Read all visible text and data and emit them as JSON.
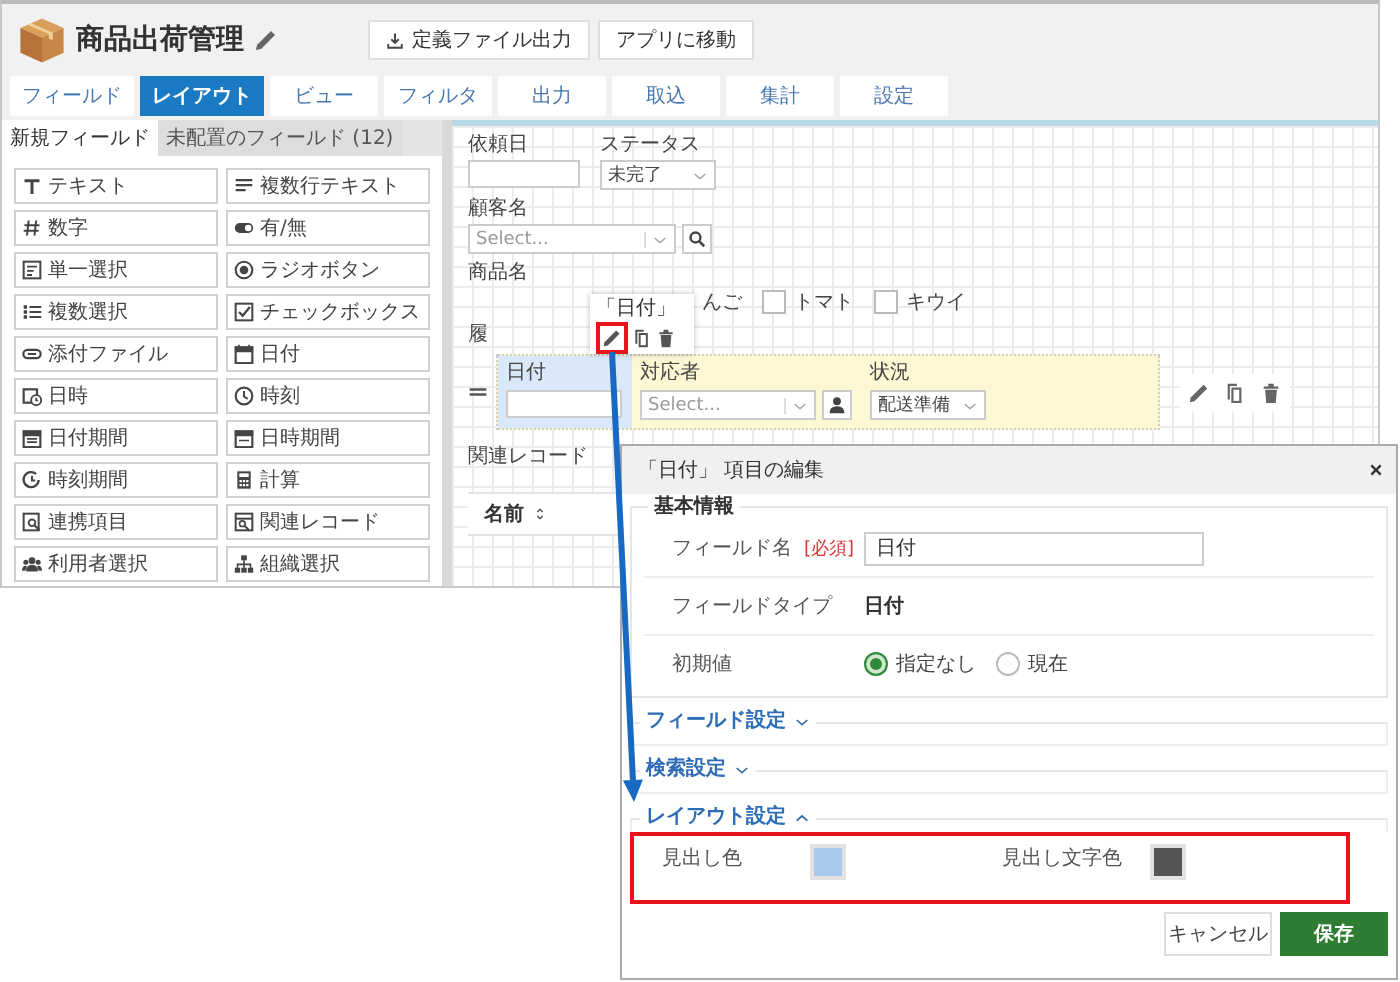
{
  "app": {
    "title": "商品出荷管理",
    "header_buttons": [
      {
        "label": "定義ファイル出力",
        "kind": "download"
      },
      {
        "label": "アプリに移動",
        "kind": "plain"
      }
    ],
    "tabs": [
      {
        "label": "フィールド",
        "selected": false
      },
      {
        "label": "レイアウト",
        "selected": true
      },
      {
        "label": "ビュー",
        "selected": false
      },
      {
        "label": "フィルタ",
        "selected": false
      },
      {
        "label": "出力",
        "selected": false
      },
      {
        "label": "取込",
        "selected": false
      },
      {
        "label": "集計",
        "selected": false
      },
      {
        "label": "設定",
        "selected": false
      }
    ],
    "sidebar": {
      "tabs": [
        {
          "label": "新規フィールド",
          "selected": true
        },
        {
          "label": "未配置のフィールド (12)",
          "selected": false
        }
      ],
      "items": [
        {
          "label": "テキスト",
          "kind": "text"
        },
        {
          "label": "複数行テキスト",
          "kind": "multiline"
        },
        {
          "label": "数字",
          "kind": "number"
        },
        {
          "label": "有/無",
          "kind": "toggle"
        },
        {
          "label": "単一選択",
          "kind": "select"
        },
        {
          "label": "ラジオボタン",
          "kind": "radio"
        },
        {
          "label": "複数選択",
          "kind": "multiselect"
        },
        {
          "label": "チェックボックス",
          "kind": "checkbox"
        },
        {
          "label": "添付ファイル",
          "kind": "file"
        },
        {
          "label": "日付",
          "kind": "date"
        },
        {
          "label": "日時",
          "kind": "datetime"
        },
        {
          "label": "時刻",
          "kind": "time"
        },
        {
          "label": "日付期間",
          "kind": "daterange"
        },
        {
          "label": "日時期間",
          "kind": "datetimerange"
        },
        {
          "label": "時刻期間",
          "kind": "timerange"
        },
        {
          "label": "計算",
          "kind": "calc"
        },
        {
          "label": "連携項目",
          "kind": "link"
        },
        {
          "label": "関連レコード",
          "kind": "related"
        },
        {
          "label": "利用者選択",
          "kind": "user"
        },
        {
          "label": "組織選択",
          "kind": "org"
        }
      ]
    },
    "canvas": {
      "request_date": {
        "label": "依頼日"
      },
      "status": {
        "label": "ステータス",
        "value": "未完了"
      },
      "customer": {
        "label": "顧客名",
        "placeholder": "Select..."
      },
      "product": {
        "label": "商品名",
        "cut_option": "んご",
        "options": [
          {
            "label": "トマト",
            "checked": false
          },
          {
            "label": "キウイ",
            "checked": false
          }
        ]
      },
      "cut_label": "履",
      "row": {
        "cells": [
          {
            "kind": "date",
            "label": "日付",
            "selected": true
          },
          {
            "kind": "user",
            "label": "対応者",
            "placeholder": "Select..."
          },
          {
            "kind": "select",
            "label": "状況",
            "value": "配送準備"
          }
        ]
      },
      "related": {
        "label": "関連レコード",
        "column": "名前"
      }
    },
    "popover": {
      "title": "「日付」"
    }
  },
  "dialog": {
    "title": "「日付」 項目の編集",
    "basic": {
      "legend": "基本情報",
      "name_label": "フィールド名",
      "required": "[必須]",
      "name_value": "日付",
      "type_label": "フィールドタイプ",
      "type_value": "日付",
      "initial_label": "初期値",
      "initial_options": [
        {
          "label": "指定なし",
          "selected": true
        },
        {
          "label": "現在",
          "selected": false
        }
      ]
    },
    "sections": [
      {
        "label": "フィールド設定",
        "expanded": false
      },
      {
        "label": "検索設定",
        "expanded": false
      },
      {
        "label": "レイアウト設定",
        "expanded": true
      }
    ],
    "layout": [
      {
        "label": "見出し色",
        "color": "#a9c9ec"
      },
      {
        "label": "見出し文字色",
        "color": "#555555"
      }
    ],
    "buttons": [
      {
        "label": "キャンセル",
        "kind": "secondary"
      },
      {
        "label": "保存",
        "kind": "primary"
      }
    ]
  }
}
